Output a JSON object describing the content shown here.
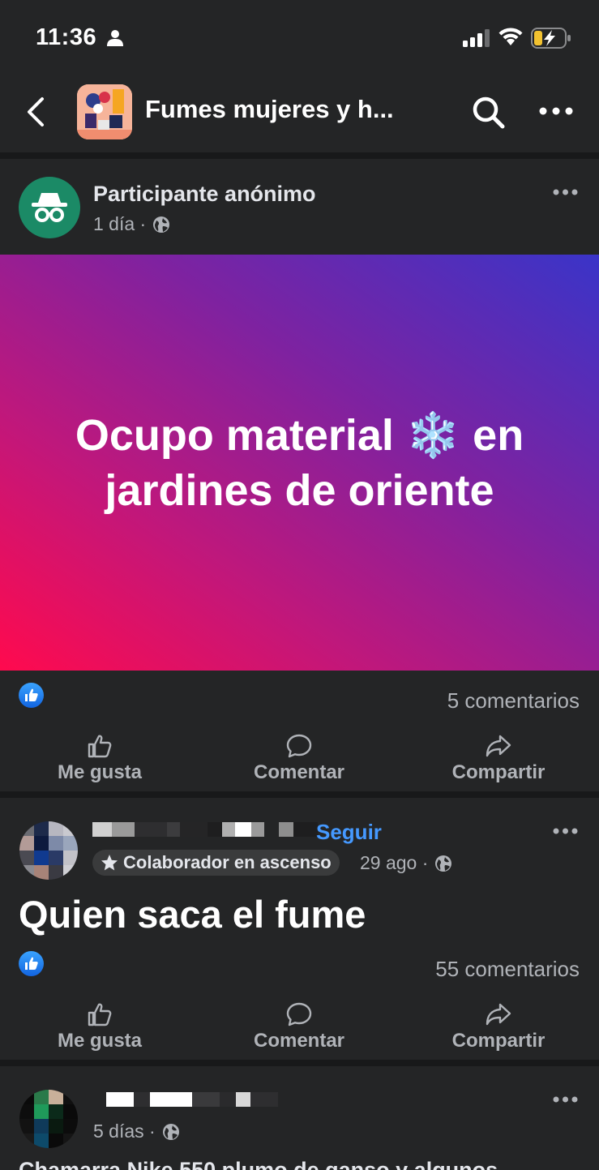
{
  "status_bar": {
    "time": "11:36",
    "icons": [
      "person-icon",
      "signal-icon",
      "wifi-icon",
      "battery-charging-icon"
    ]
  },
  "header": {
    "title": "Fumes mujeres y h...",
    "icons": [
      "back-icon",
      "group-avatar",
      "search-icon",
      "more-icon"
    ]
  },
  "posts": [
    {
      "author": "Participante anónimo",
      "time": "1 día ·",
      "banner_text": "Ocupo material ❄️ en jardines de oriente",
      "comments": "5 comentarios",
      "actions": [
        "Me gusta",
        "Comentar",
        "Compartir"
      ]
    },
    {
      "follow": "Seguir",
      "badge": "Colaborador en ascenso",
      "time": "29 ago ·",
      "text": "Quien  saca el fume",
      "comments": "55 comentarios",
      "actions": [
        "Me gusta",
        "Comentar",
        "Compartir"
      ]
    },
    {
      "time": "5 días ·",
      "text": "Chamarra Nike 550 plumo de ganso y algunos"
    }
  ],
  "colors": {
    "background": "#242526",
    "divider": "#18191a",
    "accent": "#4599ff",
    "anon_avatar": "#1b8a66"
  }
}
